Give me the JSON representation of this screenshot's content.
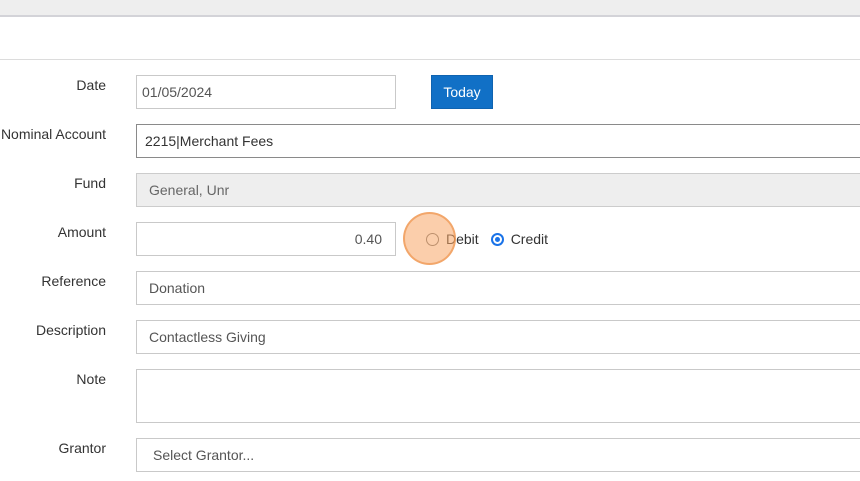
{
  "form": {
    "date": {
      "label": "Date",
      "value": "01/05/2024",
      "today_label": "Today"
    },
    "nominal_account": {
      "label": "Nominal Account",
      "value": "2215|Merchant Fees"
    },
    "fund": {
      "label": "Fund",
      "value": "General, Unr"
    },
    "amount": {
      "label": "Amount",
      "value": "0.40",
      "debit_label": "Debit",
      "credit_label": "Credit",
      "selected": "Credit"
    },
    "reference": {
      "label": "Reference",
      "value": "Donation"
    },
    "description": {
      "label": "Description",
      "value": "Contactless Giving"
    },
    "note": {
      "label": "Note",
      "value": ""
    },
    "grantor": {
      "label": "Grantor",
      "placeholder": "Select Grantor..."
    }
  },
  "colors": {
    "accent": "#1170c6",
    "click_indicator": "#f7a666"
  }
}
